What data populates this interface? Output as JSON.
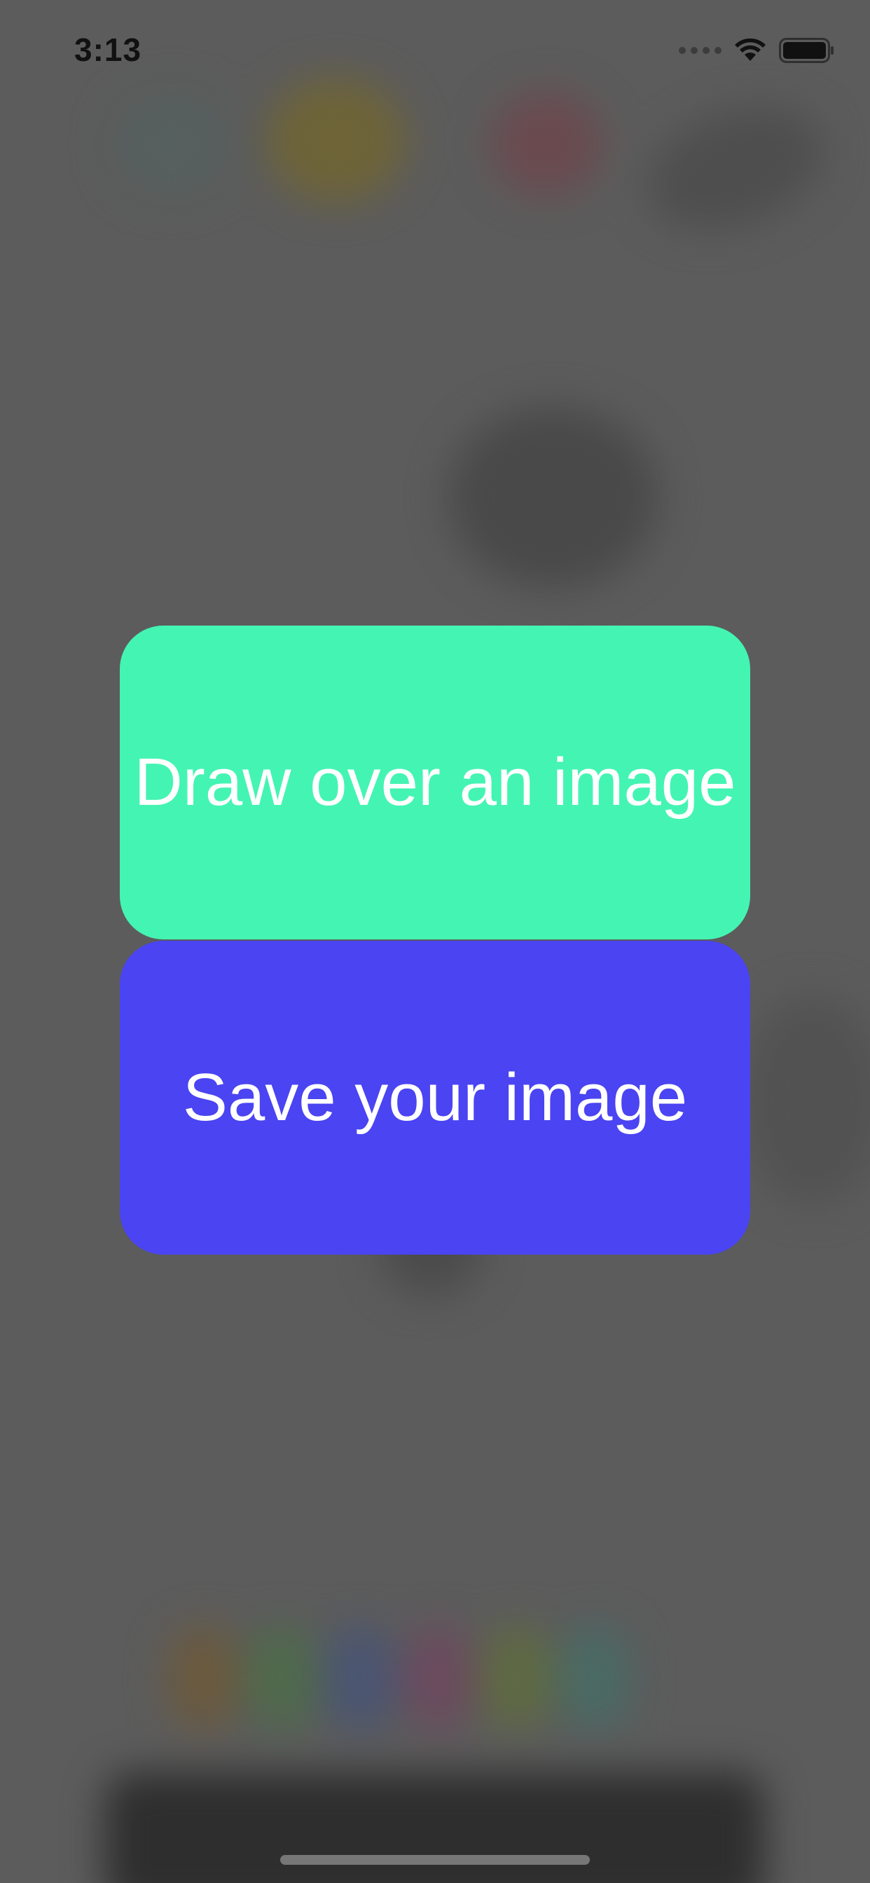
{
  "status_bar": {
    "time": "3:13"
  },
  "buttons": {
    "draw_label": "Draw over an image",
    "save_label": "Save your image"
  },
  "colors": {
    "draw_button": "#44f4b3",
    "save_button": "#4a44f2",
    "overlay": "#5c5c5c"
  },
  "icons": {
    "signal": "signal-dots-icon",
    "wifi": "wifi-icon",
    "battery": "battery-icon"
  }
}
